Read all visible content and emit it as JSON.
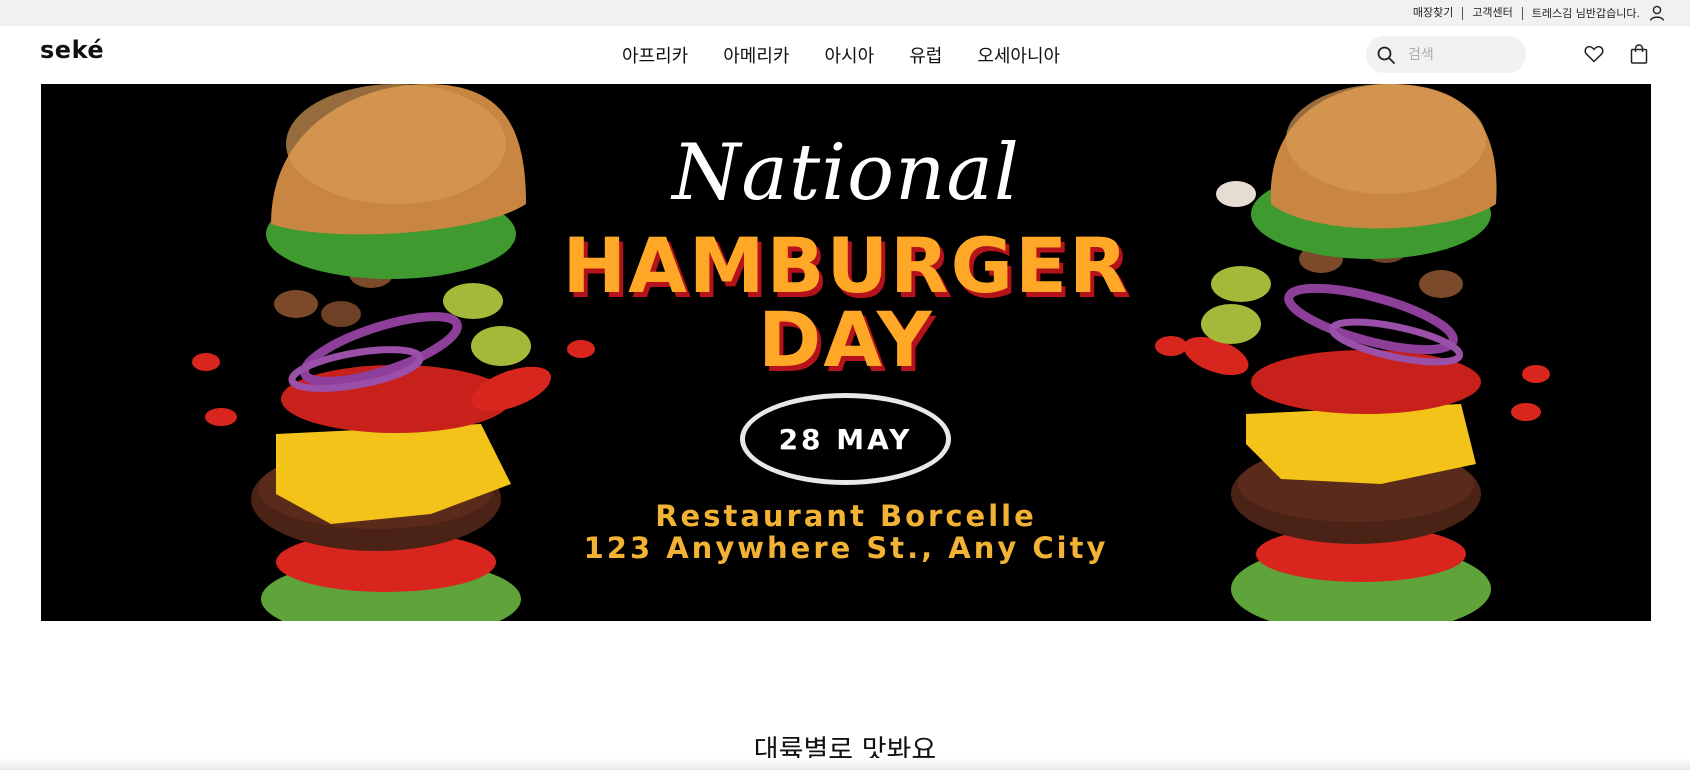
{
  "util_bar": {
    "links": [
      "매장찾기",
      "고객센터"
    ],
    "greeting": "트레스김 님반갑습니다.",
    "user_icon": "user-icon"
  },
  "header": {
    "logo": "seké",
    "nav": [
      "아프리카",
      "아메리카",
      "아시아",
      "유럽",
      "오세아니아"
    ],
    "search": {
      "placeholder": "검색",
      "value": "",
      "icon": "search-icon"
    },
    "icons": [
      "heart-icon",
      "shopping-bag-icon"
    ]
  },
  "banner": {
    "script_text": "National",
    "headline_line1": "HAMBURGER",
    "headline_line2": "DAY",
    "date": "28 MAY",
    "restaurant": "Restaurant Borcelle",
    "address": "123 Anywhere St., Any City",
    "colors": {
      "background": "#000000",
      "headline": "#ffa726",
      "headline_shadow": "#b5121b",
      "info": "#f2b234"
    }
  },
  "main": {
    "section_title": "대륙별로 맛봐요"
  }
}
